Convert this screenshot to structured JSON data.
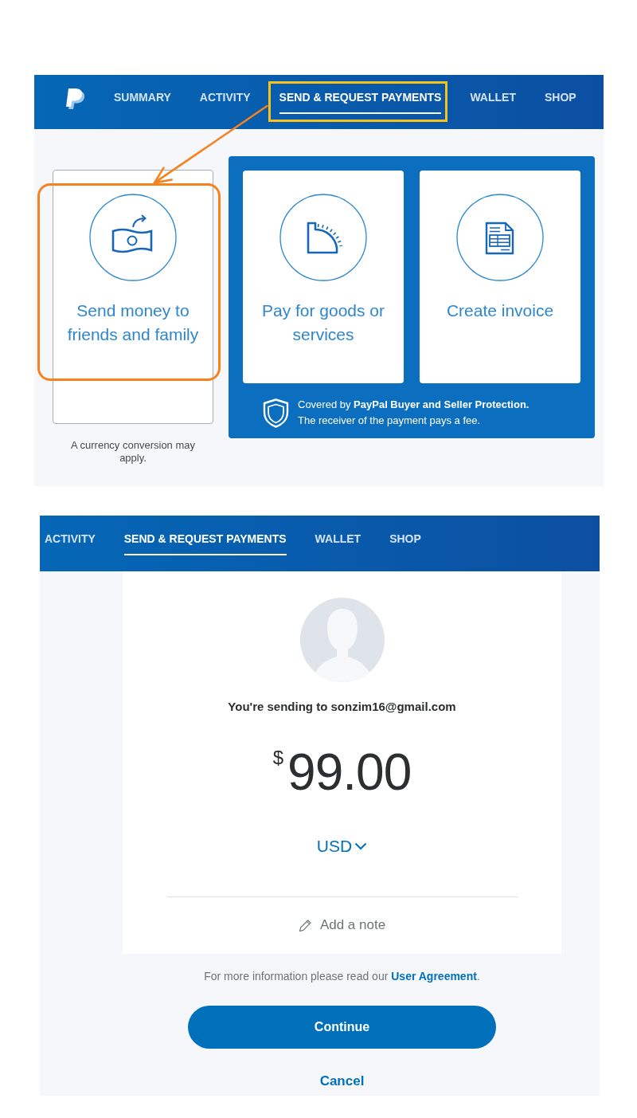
{
  "screens": [
    {
      "kind": "options",
      "nav": {
        "logo": true,
        "tabs": [
          {
            "label": "SUMMARY",
            "selected": false,
            "highlighted": false
          },
          {
            "label": "ACTIVITY",
            "selected": false,
            "highlighted": false
          },
          {
            "label": "SEND & REQUEST PAYMENTS",
            "selected": true,
            "highlighted": true
          },
          {
            "label": "WALLET",
            "selected": false,
            "highlighted": false
          },
          {
            "label": "SHOP",
            "selected": false,
            "highlighted": false
          }
        ]
      },
      "personal": {
        "kind": "send",
        "label": "Send money to friends and family",
        "highlighted": true,
        "note": "A currency conversion may apply."
      },
      "business": {
        "options": [
          {
            "kind": "goods",
            "label": "Pay for goods or services",
            "highlighted": false
          },
          {
            "kind": "invoice",
            "label": "Create invoice",
            "highlighted": false
          }
        ],
        "protection": [
          "Covered by **PayPal Buyer and Seller Protection.**",
          "The receiver of the payment pays a fee."
        ]
      }
    },
    {
      "kind": "send_form",
      "nav": {
        "logo": false,
        "tabs": [
          {
            "label": "ACTIVITY",
            "selected": false,
            "highlighted": false
          },
          {
            "label": "SEND & REQUEST PAYMENTS",
            "selected": true,
            "highlighted": false
          },
          {
            "label": "WALLET",
            "selected": false,
            "highlighted": false
          },
          {
            "label": "SHOP",
            "selected": false,
            "highlighted": false
          }
        ]
      },
      "recipient": "You're sending to sonzim16@gmail.com",
      "amount": {
        "symbol": "$",
        "value": "99.00"
      },
      "currency": "USD",
      "add_note": "Add a note",
      "agreement": {
        "text": "For more information please read our",
        "link": "User Agreement",
        "end": "."
      },
      "buttons": [
        {
          "kind": "primary",
          "label": "Continue"
        },
        {
          "kind": "link",
          "label": "Cancel"
        }
      ]
    }
  ]
}
